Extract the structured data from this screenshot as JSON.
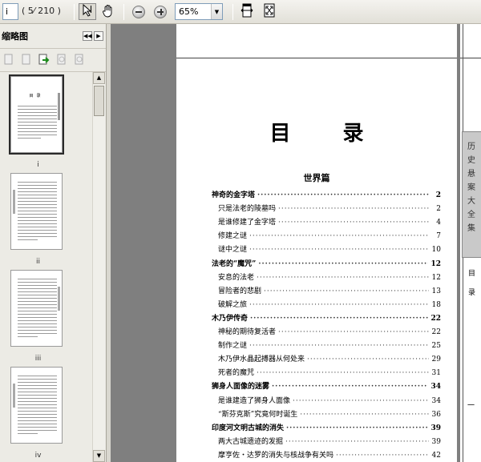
{
  "toolbar": {
    "page_value": "i",
    "page_total": "( 5⁄ 210 )",
    "zoom_value": "65%"
  },
  "sidebar": {
    "title": "缩略图",
    "thumbnails": [
      {
        "label": "i",
        "selected": true
      },
      {
        "label": "ii",
        "selected": false
      },
      {
        "label": "iii",
        "selected": false
      },
      {
        "label": "iv",
        "selected": false
      }
    ]
  },
  "document": {
    "title": "目 录",
    "section": "世界篇",
    "toc": [
      {
        "text": "神奇的金字塔",
        "page": "2",
        "level": 1
      },
      {
        "text": "只是法老的陵墓吗",
        "page": "2",
        "level": 2
      },
      {
        "text": "是谁修建了金字塔",
        "page": "4",
        "level": 2
      },
      {
        "text": "修建之谜",
        "page": "7",
        "level": 2
      },
      {
        "text": "谜中之谜",
        "page": "10",
        "level": 2
      },
      {
        "text": "法老的“魔咒”",
        "page": "12",
        "level": 1
      },
      {
        "text": "安息的法老",
        "page": "12",
        "level": 2
      },
      {
        "text": "冒险者的悲剧",
        "page": "13",
        "level": 2
      },
      {
        "text": "破解之旅",
        "page": "18",
        "level": 2
      },
      {
        "text": "木乃伊传奇",
        "page": "22",
        "level": 1
      },
      {
        "text": "神秘的期待复活者",
        "page": "22",
        "level": 2
      },
      {
        "text": "制作之谜",
        "page": "25",
        "level": 2
      },
      {
        "text": "木乃伊水晶起搏器从何处来",
        "page": "29",
        "level": 2
      },
      {
        "text": "死者的魔咒",
        "page": "31",
        "level": 2
      },
      {
        "text": "狮身人面像的迷雾",
        "page": "34",
        "level": 1
      },
      {
        "text": "是谁建造了狮身人面像",
        "page": "34",
        "level": 2
      },
      {
        "text": "“斯芬克斯”究竟何时诞生",
        "page": "36",
        "level": 2
      },
      {
        "text": "印度河文明古城的消失",
        "page": "39",
        "level": 1
      },
      {
        "text": "两大古城遗迹的发掘",
        "page": "39",
        "level": 2
      },
      {
        "text": "摩亨佐・达罗的消失与核战争有关吗",
        "page": "42",
        "level": 2
      }
    ],
    "right_page": {
      "spine_text": "历史悬案大全集",
      "side_text": "目录",
      "footer_mark": "一"
    }
  }
}
